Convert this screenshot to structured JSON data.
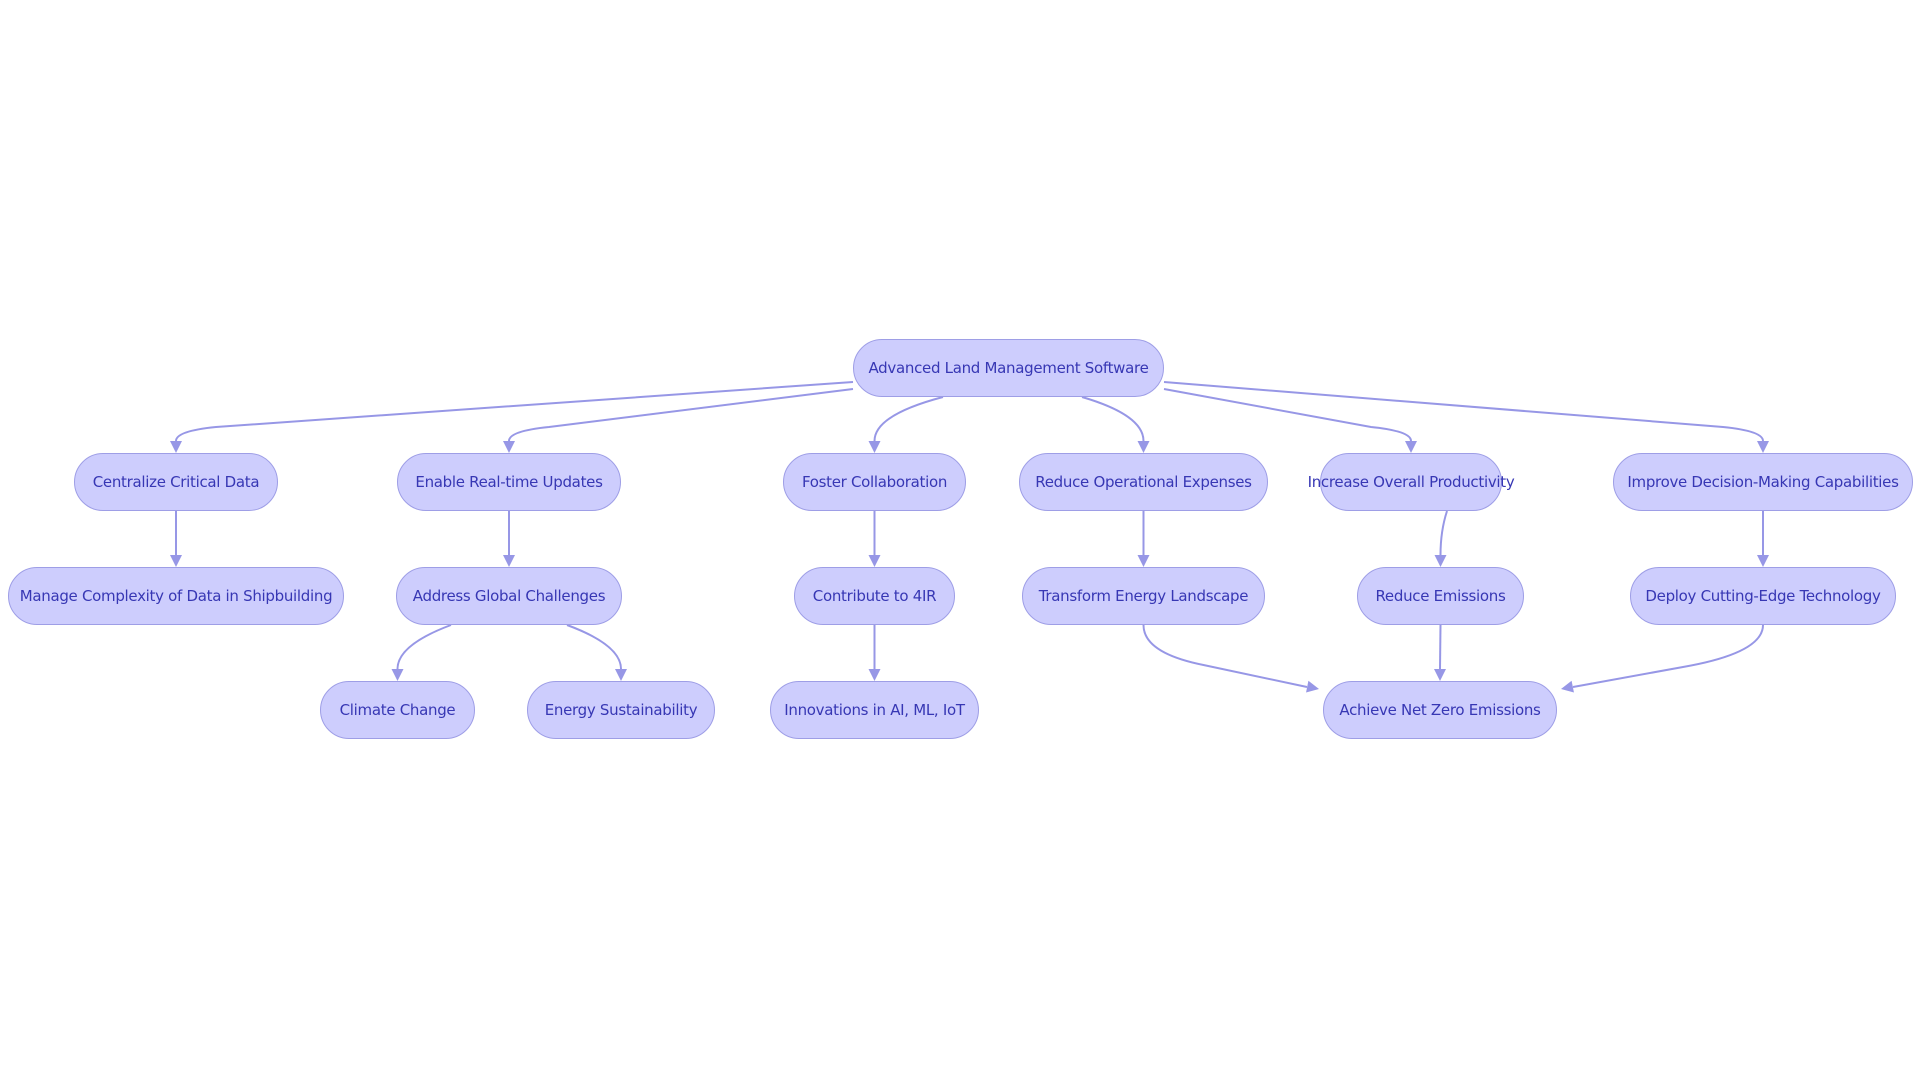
{
  "diagram": {
    "type": "flowchart",
    "direction": "top-down",
    "colors": {
      "node_fill": "#cdcdfd",
      "node_border": "#9e9ee6",
      "node_text": "#3737b4",
      "edge": "#9797e6",
      "background": "#ffffff"
    },
    "nodes": [
      {
        "id": "root",
        "label": "Advanced Land Management Software"
      },
      {
        "id": "centralize",
        "label": "Centralize Critical Data"
      },
      {
        "id": "enable",
        "label": "Enable Real-time Updates"
      },
      {
        "id": "foster",
        "label": "Foster Collaboration"
      },
      {
        "id": "reduceops",
        "label": "Reduce Operational Expenses"
      },
      {
        "id": "increase",
        "label": "Increase Overall Productivity"
      },
      {
        "id": "improve",
        "label": "Improve Decision-Making Capabilities"
      },
      {
        "id": "manage",
        "label": "Manage Complexity of Data in Shipbuilding"
      },
      {
        "id": "address",
        "label": "Address Global Challenges"
      },
      {
        "id": "contribute",
        "label": "Contribute to 4IR"
      },
      {
        "id": "transform",
        "label": "Transform Energy Landscape"
      },
      {
        "id": "reduceem",
        "label": "Reduce Emissions"
      },
      {
        "id": "deploy",
        "label": "Deploy Cutting-Edge Technology"
      },
      {
        "id": "climate",
        "label": "Climate Change"
      },
      {
        "id": "energy",
        "label": "Energy Sustainability"
      },
      {
        "id": "innovations",
        "label": "Innovations in AI, ML, IoT"
      },
      {
        "id": "netzero",
        "label": "Achieve Net Zero Emissions"
      }
    ],
    "edges": [
      {
        "from": "root",
        "to": "centralize"
      },
      {
        "from": "root",
        "to": "enable"
      },
      {
        "from": "root",
        "to": "foster"
      },
      {
        "from": "root",
        "to": "reduceops"
      },
      {
        "from": "root",
        "to": "increase"
      },
      {
        "from": "root",
        "to": "improve"
      },
      {
        "from": "centralize",
        "to": "manage"
      },
      {
        "from": "enable",
        "to": "address"
      },
      {
        "from": "address",
        "to": "climate"
      },
      {
        "from": "address",
        "to": "energy"
      },
      {
        "from": "foster",
        "to": "contribute"
      },
      {
        "from": "contribute",
        "to": "innovations"
      },
      {
        "from": "reduceops",
        "to": "transform"
      },
      {
        "from": "transform",
        "to": "netzero"
      },
      {
        "from": "increase",
        "to": "reduceem"
      },
      {
        "from": "reduceem",
        "to": "netzero"
      },
      {
        "from": "improve",
        "to": "deploy"
      },
      {
        "from": "deploy",
        "to": "netzero"
      }
    ]
  }
}
